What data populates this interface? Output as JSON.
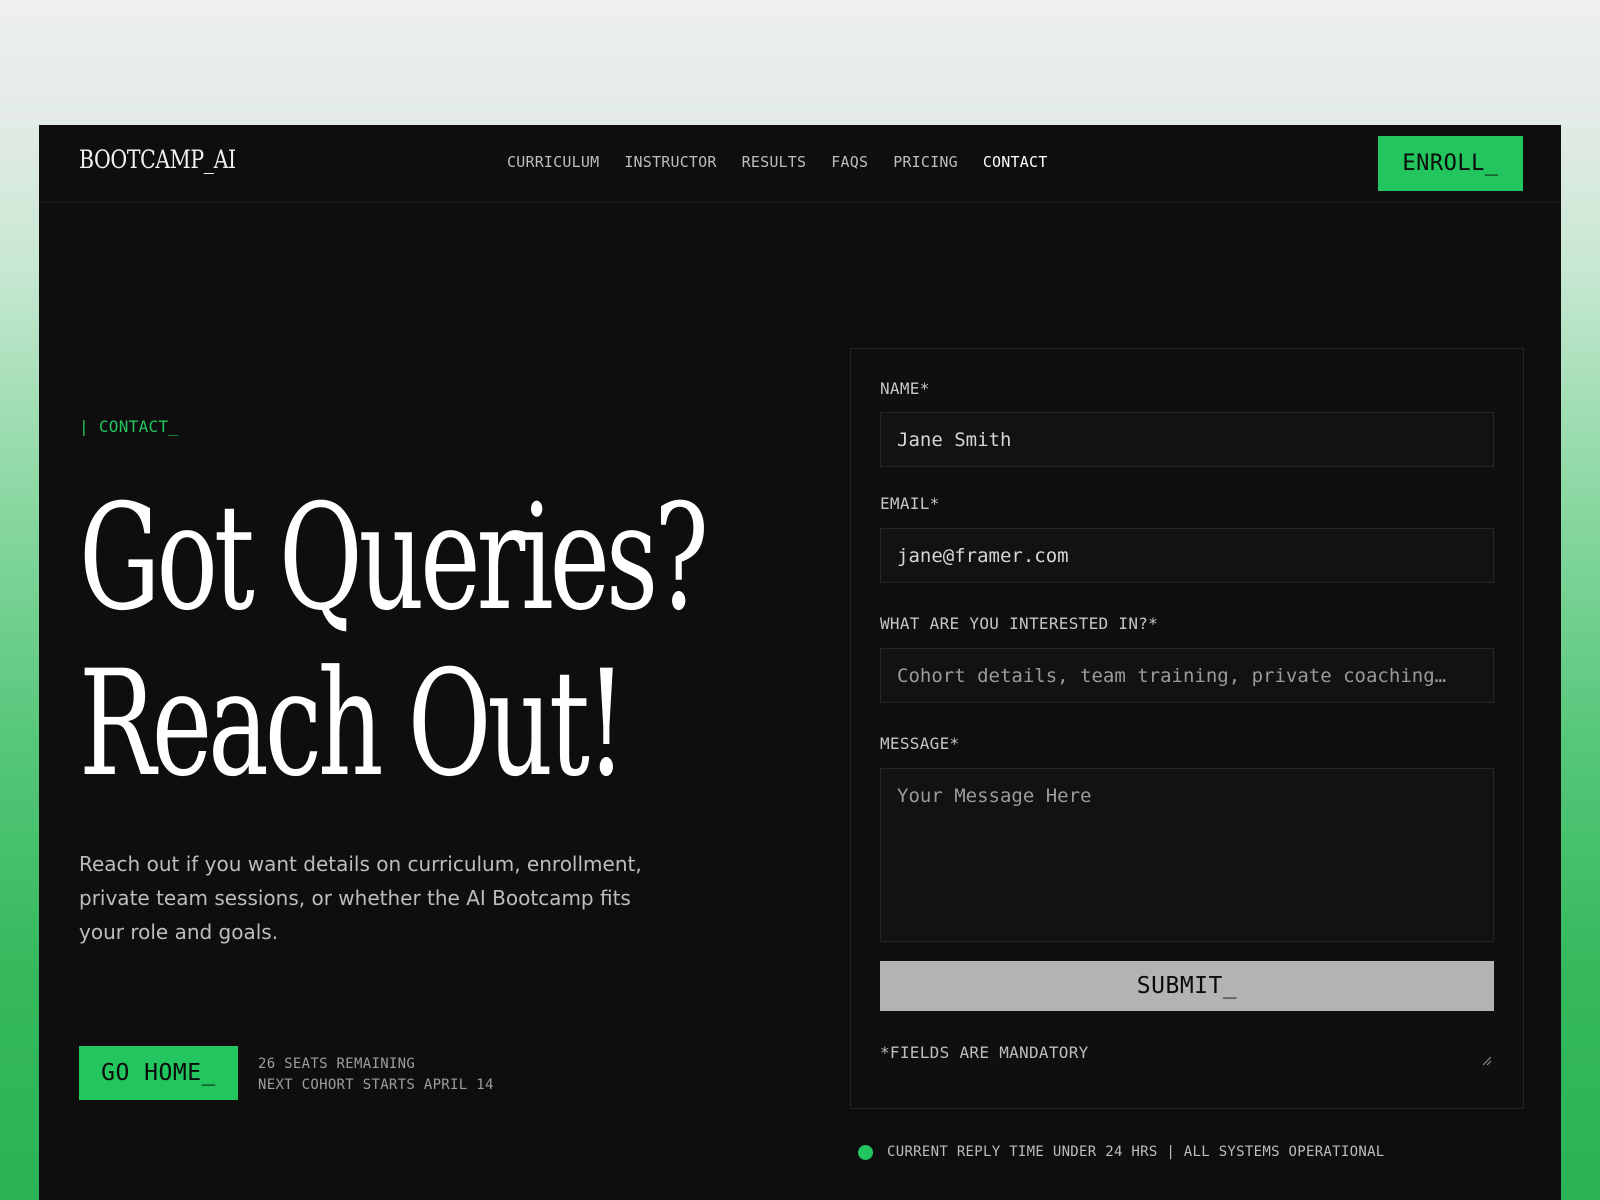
{
  "brand": {
    "logo": "BOOTCAMP_AI",
    "accent": "#22c55e"
  },
  "nav": {
    "items": [
      {
        "label": "CURRICULUM",
        "active": false
      },
      {
        "label": "INSTRUCTOR",
        "active": false
      },
      {
        "label": "RESULTS",
        "active": false
      },
      {
        "label": "FAQS",
        "active": false
      },
      {
        "label": "PRICING",
        "active": false
      },
      {
        "label": "CONTACT",
        "active": true
      }
    ],
    "cta_label": "ENROLL_"
  },
  "hero": {
    "eyebrow": "| CONTACT_",
    "headline_line1": "Got Queries?",
    "headline_line2": "Reach Out!",
    "lead": "Reach out if you want details on curriculum, enrollment, private team sessions, or whether the AI Bootcamp fits your role and goals.",
    "go_home_label": "GO HOME_",
    "seats_remaining": "26 SEATS REMAINING",
    "next_cohort": "NEXT COHORT STARTS APRIL 14"
  },
  "form": {
    "name_label": "NAME*",
    "name_value": "Jane Smith",
    "email_label": "EMAIL*",
    "email_value": "jane@framer.com",
    "interest_label": "WHAT ARE YOU INTERESTED IN?*",
    "interest_placeholder": "Cohort details, team training, private coaching…",
    "message_label": "MESSAGE*",
    "message_placeholder": "Your Message Here",
    "submit_label": "SUBMIT_",
    "mandatory_note": "*FIELDS ARE MANDATORY"
  },
  "status": {
    "text": "CURRENT REPLY TIME UNDER 24 HRS | ALL SYSTEMS OPERATIONAL",
    "dot_color": "#22c55e"
  }
}
